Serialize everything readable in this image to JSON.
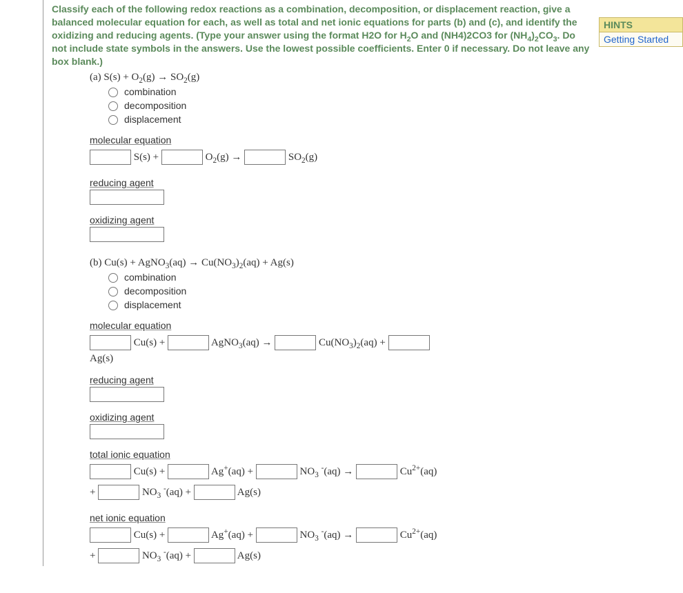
{
  "instructions": "Classify each of the following redox reactions as a combination, decomposition, or displacement reaction, give a balanced molecular equation for each, as well as total and net ionic equations for parts (b) and (c), and identify the oxidizing and reducing agents. (Type your answer using the format H2O for H₂O and (NH4)2CO3 for (NH₄)₂CO₃. Do not include state symbols in the answers. Use the lowest possible coefficients. Enter 0 if necessary. Do not leave any box blank.)",
  "hints": {
    "title": "HINTS",
    "link": "Getting Started"
  },
  "labels": {
    "combination": "combination",
    "decomposition": "decomposition",
    "displacement": "displacement",
    "molecular_equation": "molecular equation",
    "reducing_agent": "reducing agent",
    "oxidizing_agent": "oxidizing agent",
    "total_ionic_equation": "total ionic equation",
    "net_ionic_equation": "net ionic equation"
  },
  "partA": {
    "label": "(a) S(s) + O₂(g) → SO₂(g)",
    "mol_eq": {
      "s": "S(s) +",
      "o2": "O₂(g) →",
      "so2": "SO₂(g)"
    }
  },
  "partB": {
    "label": "(b) Cu(s) + AgNO₃(aq) → Cu(NO₃)₂(aq) + Ag(s)",
    "mol_eq": {
      "cu": "Cu(s) +",
      "agno3": "AgNO₃(aq) →",
      "cuno3": "Cu(NO₃)₂(aq) +",
      "ag": "Ag(s)"
    },
    "total_ionic": {
      "cu": "Cu(s) +",
      "ag_ion": "Ag⁺(aq) +",
      "no3_l": "NO₃ ⁻(aq) →",
      "cu_ion": "Cu²⁺(aq)",
      "plus": "+",
      "no3_r": "NO₃ ⁻(aq) +",
      "ag": "Ag(s)"
    },
    "net_ionic": {
      "cu": "Cu(s) +",
      "ag_ion": "Ag⁺(aq) +",
      "no3_l": "NO₃ ⁻(aq) →",
      "cu_ion": "Cu²⁺(aq)",
      "plus": "+",
      "no3_r": "NO₃ ⁻(aq) +",
      "ag": "Ag(s)"
    }
  }
}
